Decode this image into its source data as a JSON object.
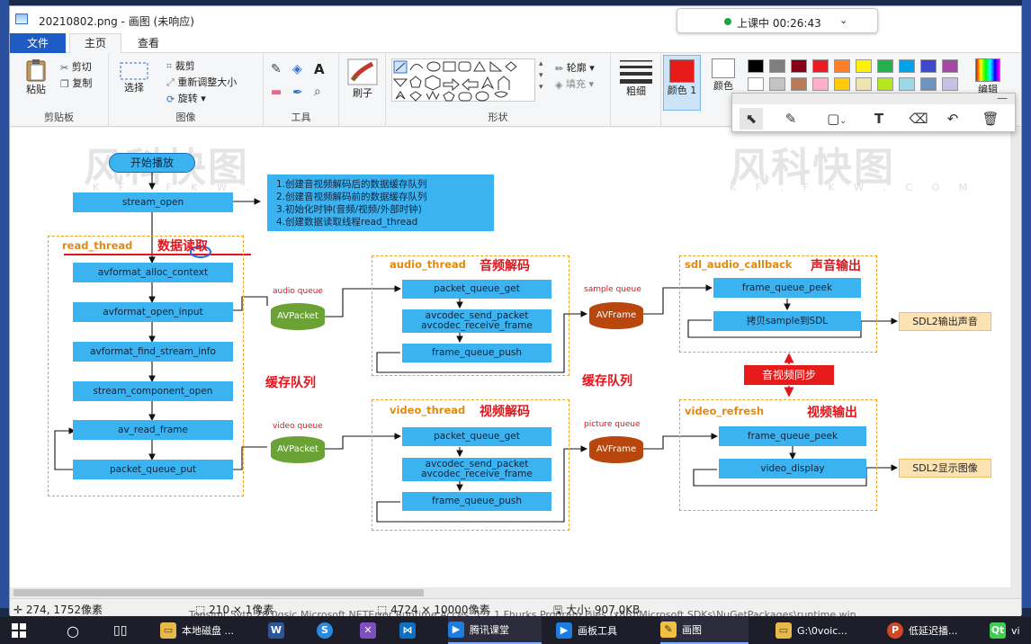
{
  "window": {
    "title": "20210802.png - 画图 (未响应)"
  },
  "class_timer": {
    "text": "上课中 00:26:43",
    "dot_color": "#1aa34a"
  },
  "tabs": {
    "file": "文件",
    "home": "主页",
    "view": "查看"
  },
  "ribbon": {
    "clipboard": {
      "paste": "粘贴",
      "cut": "剪切",
      "copy": "复制",
      "label": "剪贴板"
    },
    "image": {
      "select": "选择",
      "crop": "裁剪",
      "resize": "重新调整大小",
      "rotate": "旋转",
      "label": "图像"
    },
    "tools": {
      "label": "工具"
    },
    "brush": {
      "label": "刷子"
    },
    "shapes": {
      "outline": "轮廓",
      "fill": "填充",
      "label": "形状"
    },
    "size": {
      "label": "粗细"
    },
    "color1": {
      "label": "颜色 1",
      "value": "#e81b1b"
    },
    "color2": {
      "label": "颜色"
    },
    "edit_colors": "编辑",
    "palette": [
      "#000000",
      "#7f7f7f",
      "#880015",
      "#ed1c24",
      "#ff7f27",
      "#fff200",
      "#22b14c",
      "#00a2e8",
      "#3f48cc",
      "#a349a4",
      "#ffffff",
      "#c3c3c3",
      "#b97a57",
      "#ffaec9",
      "#ffc90e",
      "#efe4b0",
      "#b5e61d",
      "#99d9ea",
      "#7092be",
      "#c8bfe7"
    ]
  },
  "draw_toolbar": {
    "tools": [
      "pointer-icon",
      "pen-icon",
      "rectangle-icon",
      "text-icon",
      "eraser-icon",
      "undo-icon",
      "trash-icon"
    ]
  },
  "diagram": {
    "start": "开始播放",
    "stream_open": "stream_open",
    "notes": [
      "1.创建音视频解码后的数据缓存队列",
      "2.创建音视频解码前的数据缓存队列",
      "3.初始化时钟(音频/视频/外部时钟)",
      "4.创建数据读取线程read_thread"
    ],
    "read_thread": {
      "title": "read_thread",
      "title_cn": "数据读取",
      "steps": [
        "avformat_alloc_context",
        "avformat_open_input",
        "avformat_find_stream_info",
        "stream_component_open",
        "av_read_frame",
        "packet_queue_put"
      ]
    },
    "audio_queue": {
      "label": "audio queue",
      "item": "AVPacket"
    },
    "video_queue": {
      "label": "video queue",
      "item": "AVPacket"
    },
    "cache_queue_left": "缓存队列",
    "cache_queue_right": "缓存队列",
    "audio_thread": {
      "title": "audio_thread",
      "title_cn": "音频解码",
      "steps": [
        "packet_queue_get",
        "avcodec_send_packet",
        "avcodec_receive_frame",
        "frame_queue_push"
      ]
    },
    "video_thread": {
      "title": "video_thread",
      "title_cn": "视频解码",
      "steps": [
        "packet_queue_get",
        "avcodec_send_packet",
        "avcodec_receive_frame",
        "frame_queue_push"
      ]
    },
    "sample_queue": {
      "label": "sample queue",
      "item": "AVFrame"
    },
    "picture_queue": {
      "label": "picture queue",
      "item": "AVFrame"
    },
    "sdl_audio": {
      "title": "sdl_audio_callback",
      "title_cn": "声音输出",
      "steps": [
        "frame_queue_peek",
        "拷贝sample到SDL"
      ],
      "output": "SDL2输出声音"
    },
    "sync": "音视频同步",
    "video_refresh": {
      "title": "video_refresh",
      "title_cn": "视频输出",
      "steps": [
        "frame_queue_peek",
        "video_display"
      ],
      "output": "SDL2显示图像"
    },
    "watermark": "风科快图",
    "watermark_sub": "K F . F K W . C O M"
  },
  "statusbar": {
    "cursor": "274, 1752像素",
    "selection": "210 × 1像素",
    "image_size": "4724 × 10000像素",
    "file_size": "大小: 907.0KB"
  },
  "taskbar": {
    "items": [
      {
        "label": "",
        "icon": "start-icon"
      },
      {
        "label": "",
        "icon": "search-icon"
      },
      {
        "label": "",
        "icon": "task-view-icon"
      },
      {
        "label": "本地磁盘 ...",
        "icon": "folder-icon"
      },
      {
        "label": "",
        "icon": "word-icon"
      },
      {
        "label": "",
        "icon": "sogou-icon"
      },
      {
        "label": "",
        "icon": "vscode-icon"
      },
      {
        "label": "腾讯课堂",
        "icon": "tencent-class-icon"
      },
      {
        "label": "画板工具",
        "icon": "board-tool-icon"
      },
      {
        "label": "画图",
        "icon": "paint-icon"
      },
      {
        "label": "G:\\0voic...",
        "icon": "explorer-icon"
      },
      {
        "label": "低延迟播...",
        "icon": "powerpoint-icon"
      },
      {
        "label": "vi",
        "icon": "qt-icon"
      }
    ],
    "overlay": "Tonsimt 5vtn.28.0qsic Microsoft.NETError Runtime Acces..1.7.1 Fhurks   Program Files (x86)\\Microsoft SDKs\\NuGetPackages\\runtime win"
  }
}
